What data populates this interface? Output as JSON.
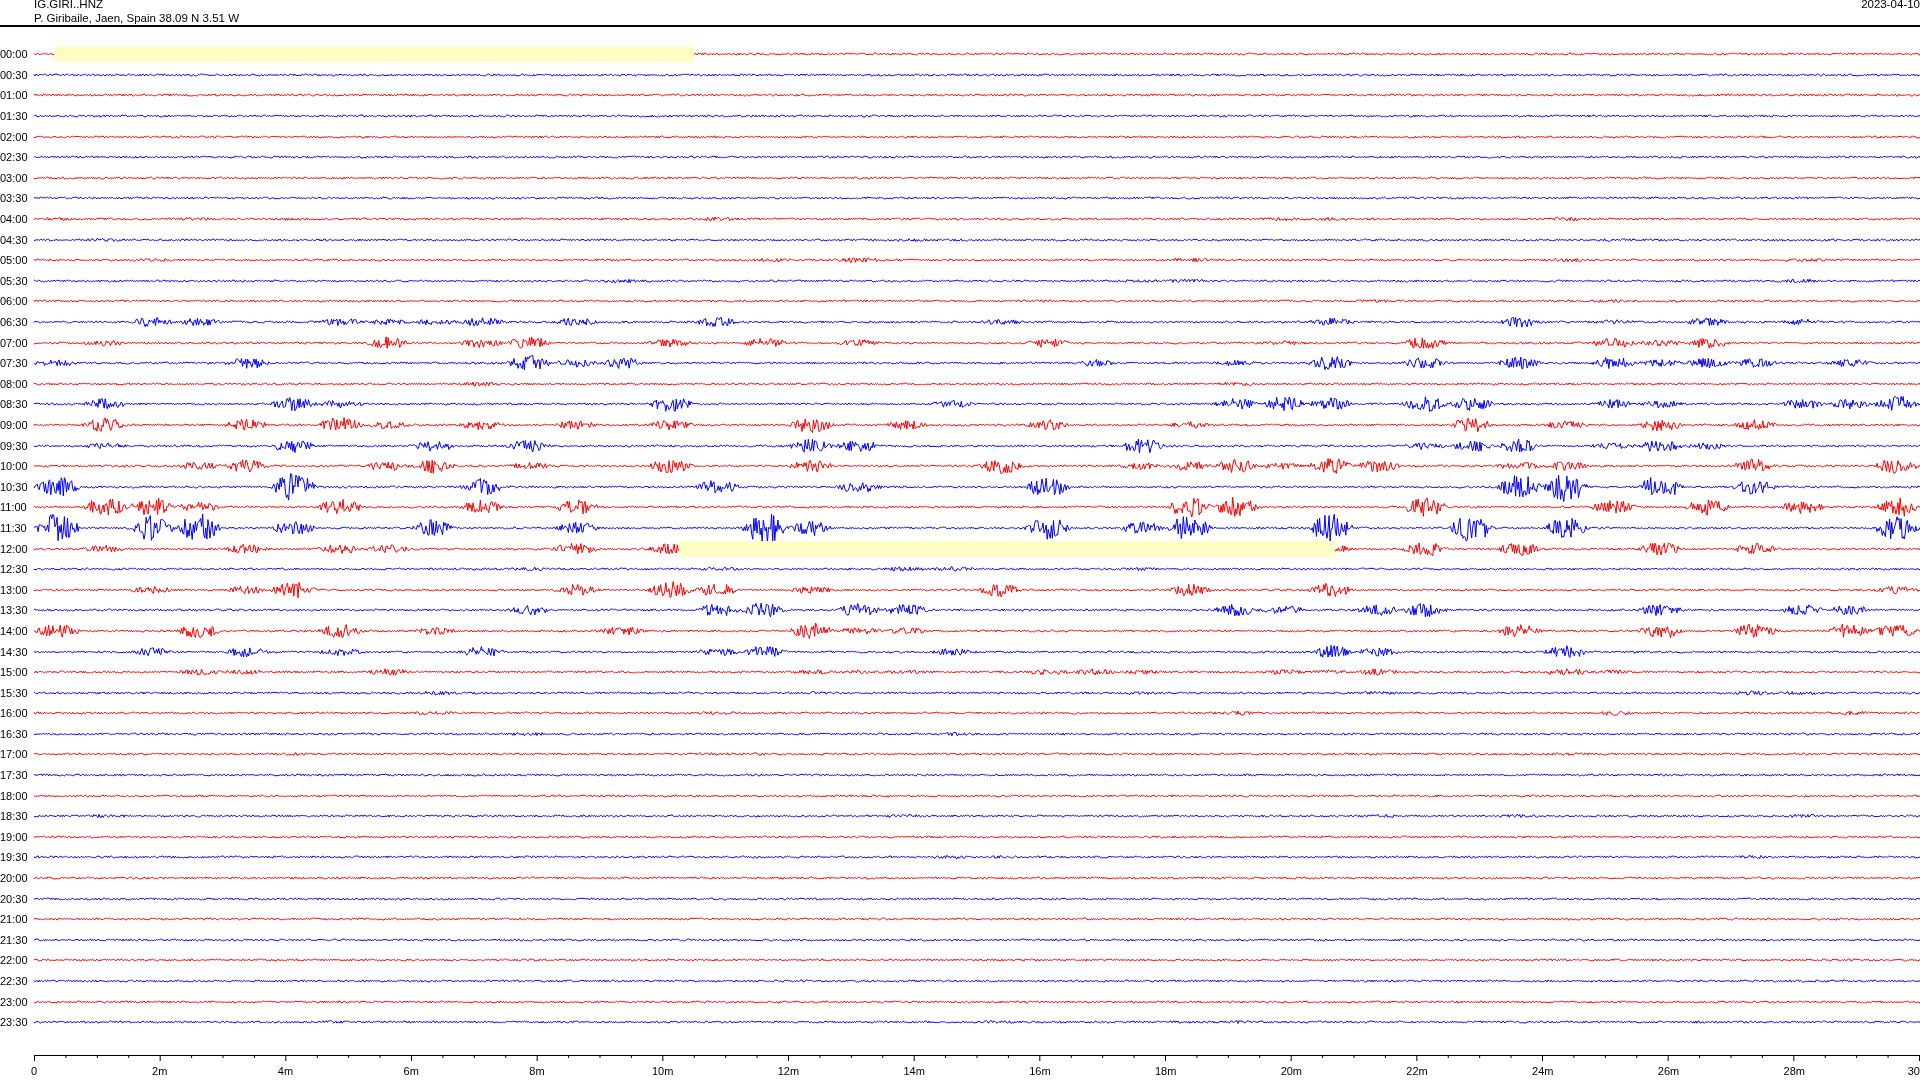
{
  "header": {
    "station": "IG.GIRI..HNZ",
    "location": "P. Giribaile, Jaen, Spain  38.09 N 3.51 W",
    "date": "2023-04-10"
  },
  "rows": [
    {
      "time": "00:00",
      "color": "#ff0000",
      "gap": true
    },
    {
      "time": "00:30",
      "color": "#0000ff",
      "gap": false
    },
    {
      "time": "01:00",
      "color": "#ff0000",
      "gap": false
    },
    {
      "time": "01:30",
      "color": "#0000ff",
      "gap": false
    },
    {
      "time": "02:00",
      "color": "#ff0000",
      "gap": false
    },
    {
      "time": "02:30",
      "color": "#0000ff",
      "gap": false
    },
    {
      "time": "03:00",
      "color": "#ff0000",
      "gap": false
    },
    {
      "time": "03:30",
      "color": "#0000ff",
      "gap": false
    },
    {
      "time": "04:00",
      "color": "#ff0000",
      "gap": false
    },
    {
      "time": "04:30",
      "color": "#0000ff",
      "gap": false
    },
    {
      "time": "05:00",
      "color": "#ff0000",
      "gap": false
    },
    {
      "time": "05:30",
      "color": "#0000ff",
      "gap": false
    },
    {
      "time": "06:00",
      "color": "#ff0000",
      "gap": false
    },
    {
      "time": "06:30",
      "color": "#0000ff",
      "gap": false
    },
    {
      "time": "07:00",
      "color": "#ff0000",
      "gap": false
    },
    {
      "time": "07:30",
      "color": "#0000ff",
      "gap": false
    },
    {
      "time": "08:00",
      "color": "#ff0000",
      "gap": false
    },
    {
      "time": "08:30",
      "color": "#0000ff",
      "gap": false
    },
    {
      "time": "09:00",
      "color": "#ff0000",
      "gap": false
    },
    {
      "time": "09:30",
      "color": "#0000ff",
      "gap": false
    },
    {
      "time": "10:00",
      "color": "#ff0000",
      "gap": false
    },
    {
      "time": "10:30",
      "color": "#0000ff",
      "gap": false
    },
    {
      "time": "11:00",
      "color": "#ff0000",
      "gap": false
    },
    {
      "time": "11:30",
      "color": "#0000ff",
      "gap": false
    },
    {
      "time": "12:00",
      "color": "#ff0000",
      "gap": true
    },
    {
      "time": "12:30",
      "color": "#0000ff",
      "gap": false
    },
    {
      "time": "13:00",
      "color": "#ff0000",
      "gap": false
    },
    {
      "time": "13:30",
      "color": "#0000ff",
      "gap": false
    },
    {
      "time": "14:00",
      "color": "#ff0000",
      "gap": false
    },
    {
      "time": "14:30",
      "color": "#0000ff",
      "gap": false
    },
    {
      "time": "15:00",
      "color": "#ff0000",
      "gap": false
    },
    {
      "time": "15:30",
      "color": "#0000ff",
      "gap": false
    },
    {
      "time": "16:00",
      "color": "#ff0000",
      "gap": false
    },
    {
      "time": "16:30",
      "color": "#0000ff",
      "gap": false
    },
    {
      "time": "17:00",
      "color": "#ff0000",
      "gap": false
    },
    {
      "time": "17:30",
      "color": "#0000ff",
      "gap": false
    },
    {
      "time": "18:00",
      "color": "#ff0000",
      "gap": false
    },
    {
      "time": "18:30",
      "color": "#0000ff",
      "gap": false
    },
    {
      "time": "19:00",
      "color": "#ff0000",
      "gap": false
    },
    {
      "time": "19:30",
      "color": "#0000ff",
      "gap": false
    },
    {
      "time": "20:00",
      "color": "#ff0000",
      "gap": false
    },
    {
      "time": "20:30",
      "color": "#0000ff",
      "gap": false
    },
    {
      "time": "21:00",
      "color": "#ff0000",
      "gap": false
    },
    {
      "time": "21:30",
      "color": "#0000ff",
      "gap": false
    },
    {
      "time": "22:00",
      "color": "#ff0000",
      "gap": false
    },
    {
      "time": "22:30",
      "color": "#0000ff",
      "gap": false
    },
    {
      "time": "23:00",
      "color": "#ff0000",
      "gap": false
    },
    {
      "time": "23:30",
      "color": "#0000ff",
      "gap": false
    }
  ],
  "x_axis": {
    "labels": [
      "0",
      "2m",
      "4m",
      "6m",
      "8m",
      "10m",
      "12m",
      "14m",
      "16m",
      "18m",
      "20m",
      "22m",
      "24m",
      "26m",
      "28m",
      "30"
    ]
  }
}
